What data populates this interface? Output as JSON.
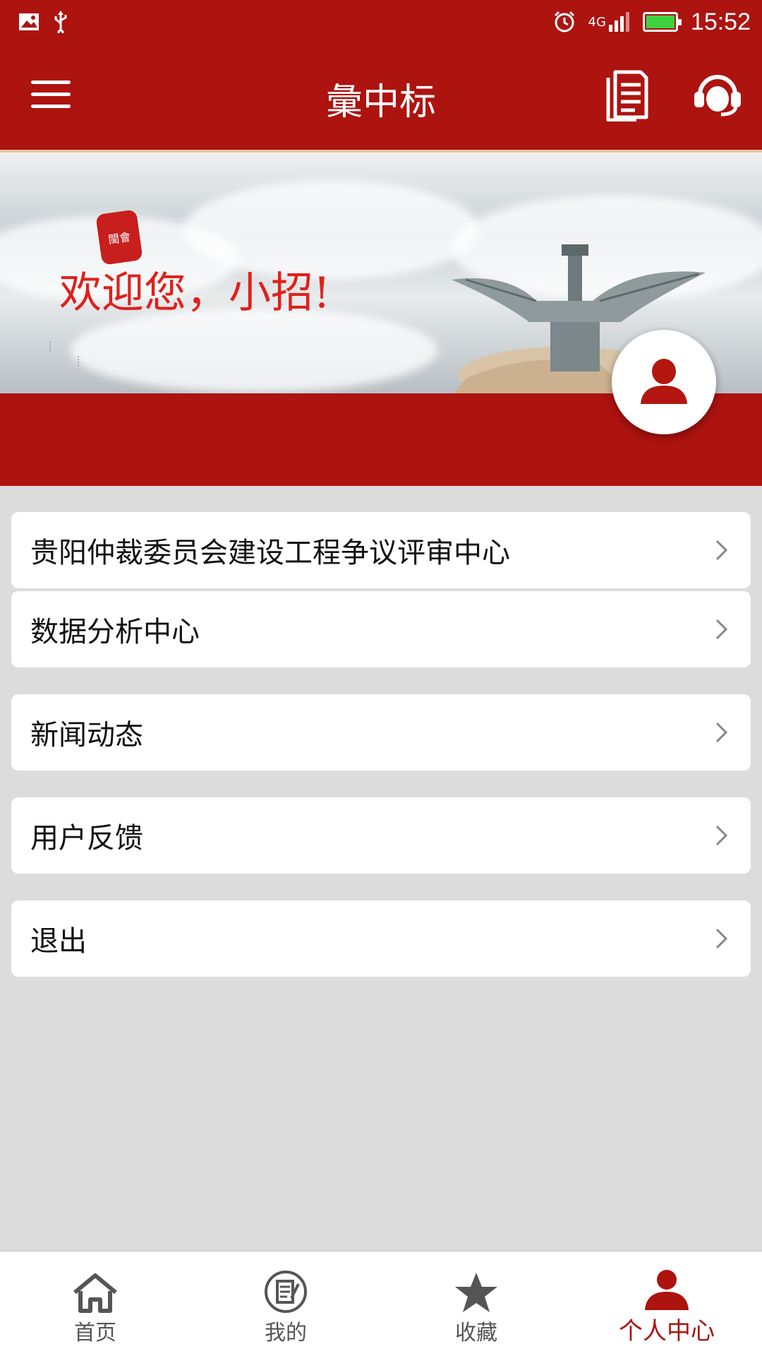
{
  "status_bar": {
    "network": "4G",
    "time": "15:52",
    "icons": [
      "image-icon",
      "usb-icon",
      "alarm-icon",
      "signal-icon",
      "battery-icon"
    ]
  },
  "header": {
    "title": "彙中标",
    "icons": [
      "menu-icon",
      "document-icon",
      "headset-icon"
    ]
  },
  "banner": {
    "welcome_text": "欢迎您，小招!",
    "seal_text": "閩會"
  },
  "menu": {
    "items": [
      {
        "label": "贵阳仲裁委员会建设工程争议评审中心"
      },
      {
        "label": "数据分析中心"
      },
      {
        "label": "新闻动态"
      },
      {
        "label": "用户反馈"
      },
      {
        "label": "退出"
      }
    ]
  },
  "tabs": [
    {
      "label": "首页",
      "icon": "home-icon",
      "active": false
    },
    {
      "label": "我的",
      "icon": "clipboard-icon",
      "active": false
    },
    {
      "label": "收藏",
      "icon": "star-icon",
      "active": false
    },
    {
      "label": "个人中心",
      "icon": "person-icon",
      "active": true
    }
  ],
  "colors": {
    "brand_red": "#ad130f",
    "welcome_red": "#e0201b",
    "background": "#dcdcdc",
    "battery_green": "#3ed23e"
  }
}
